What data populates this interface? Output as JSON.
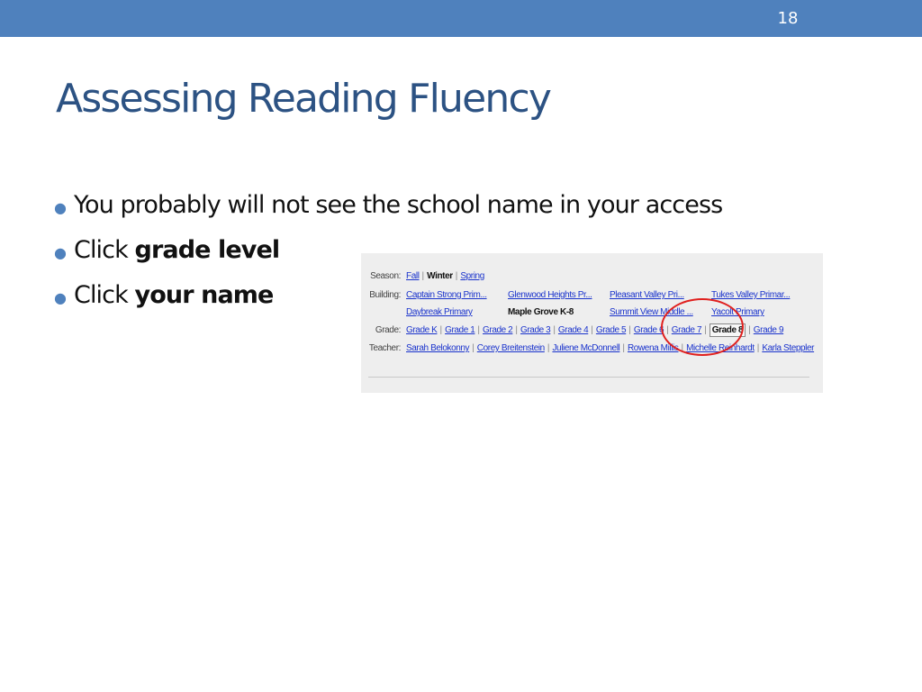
{
  "slide": {
    "number": "18",
    "title": "Assessing Reading Fluency"
  },
  "bullets": [
    {
      "text": "You probably will not see the school name in your access",
      "bold": ""
    },
    {
      "text": "Click ",
      "bold": "grade level"
    },
    {
      "text": "Click ",
      "bold": "your name"
    }
  ],
  "screenshot": {
    "season": {
      "label": "Season:",
      "items": [
        "Fall",
        "Winter",
        "Spring"
      ],
      "selected": "Winter"
    },
    "building": {
      "label": "Building:",
      "items": [
        "Captain Strong Prim...",
        "Glenwood Heights Pr...",
        "Pleasant Valley Pri...",
        "Tukes Valley Primar...",
        "Daybreak Primary",
        "Maple Grove K-8",
        "Summit View Middle ...",
        "Yacolt Primary"
      ],
      "selected": "Maple Grove K-8"
    },
    "grade": {
      "label": "Grade:",
      "items": [
        "Grade K",
        "Grade 1",
        "Grade 2",
        "Grade 3",
        "Grade 4",
        "Grade 5",
        "Grade 6",
        "Grade 7",
        "Grade 8",
        "Grade 9"
      ],
      "selected": "Grade 8"
    },
    "teacher": {
      "label": "Teacher:",
      "items": [
        "Sarah Belokonny",
        "Corey Breitenstein",
        "Juliene McDonnell",
        "Rowena Millis",
        "Michelle Reinhardt",
        "Karla Steppler"
      ]
    }
  },
  "colors": {
    "accent_bar": "#4f81bd",
    "title": "#2c5283",
    "circle": "#e0201e"
  }
}
